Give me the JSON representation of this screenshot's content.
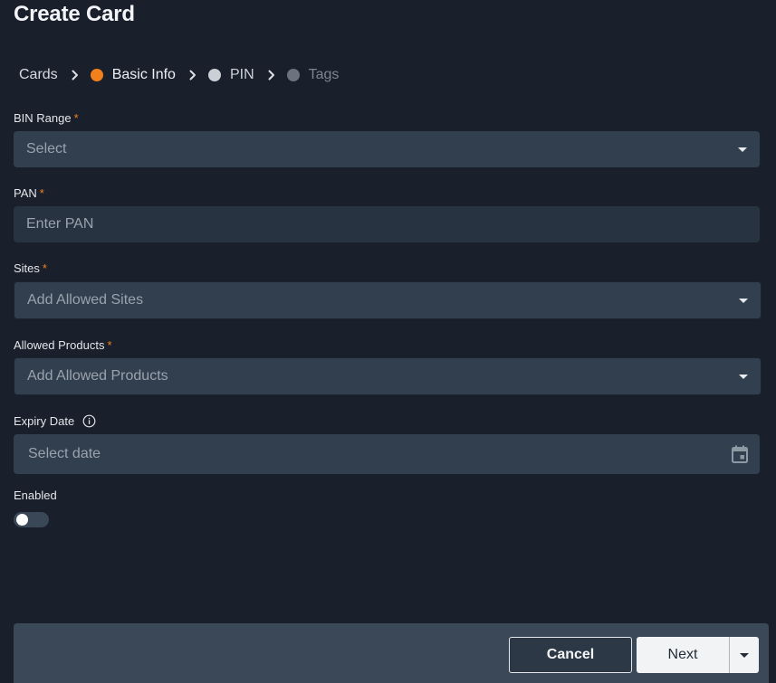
{
  "title": "Create Card",
  "breadcrumb": {
    "root": "Cards",
    "steps": [
      {
        "label": "Basic Info",
        "state": "active"
      },
      {
        "label": "PIN",
        "state": "pending"
      },
      {
        "label": "Tags",
        "state": "future"
      }
    ]
  },
  "fields": {
    "bin_range": {
      "label": "BIN Range",
      "required_mark": "*",
      "placeholder": "Select"
    },
    "pan": {
      "label": "PAN",
      "required_mark": "*",
      "placeholder": "Enter PAN"
    },
    "sites": {
      "label": "Sites",
      "required_mark": "*",
      "placeholder": "Add Allowed Sites"
    },
    "allowed_products": {
      "label": "Allowed Products",
      "required_mark": "*",
      "placeholder": "Add Allowed Products"
    },
    "expiry_date": {
      "label": "Expiry Date",
      "placeholder": "Select date",
      "icon": "info-icon",
      "picker_icon": "calendar-icon"
    },
    "enabled": {
      "label": "Enabled",
      "value": false
    }
  },
  "footer": {
    "cancel_label": "Cancel",
    "next_label": "Next"
  },
  "colors": {
    "background": "#19202b",
    "accent": "#f2801c",
    "input": "#323f4e",
    "footer": "#3a4858"
  }
}
